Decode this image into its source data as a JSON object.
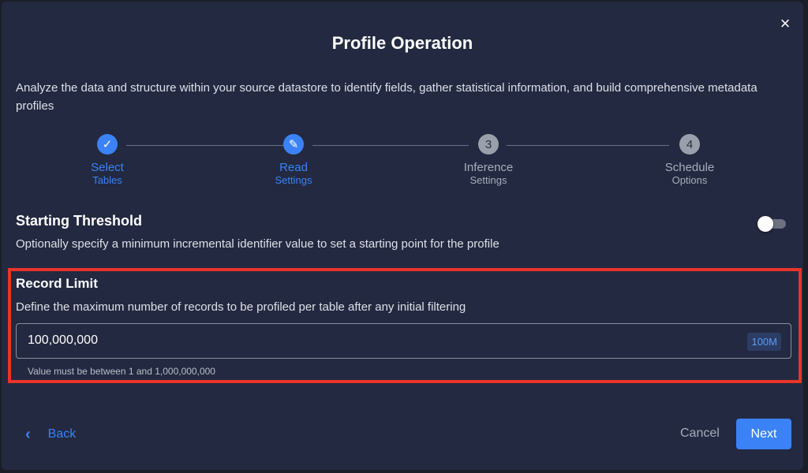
{
  "modal": {
    "title": "Profile Operation",
    "description": "Analyze the data and structure within your source datastore to identify fields, gather statistical information, and build comprehensive metadata profiles",
    "close_icon": "×"
  },
  "stepper": {
    "steps": [
      {
        "marker": "✓",
        "title": "Select",
        "subtitle": "Tables",
        "state": "completed"
      },
      {
        "marker": "✎",
        "title": "Read",
        "subtitle": "Settings",
        "state": "current"
      },
      {
        "marker": "3",
        "title": "Inference",
        "subtitle": "Settings",
        "state": "upcoming"
      },
      {
        "marker": "4",
        "title": "Schedule",
        "subtitle": "Options",
        "state": "upcoming"
      }
    ]
  },
  "starting_threshold": {
    "title": "Starting Threshold",
    "description": "Optionally specify a minimum incremental identifier value to set a starting point for the profile",
    "enabled": false
  },
  "record_limit": {
    "title": "Record Limit",
    "description": "Define the maximum number of records to be profiled per table after any initial filtering",
    "value": "100,000,000",
    "badge": "100M",
    "hint": "Value must be between 1 and 1,000,000,000"
  },
  "footer": {
    "back_icon": "‹",
    "back_label": "Back",
    "cancel_label": "Cancel",
    "next_label": "Next"
  },
  "colors": {
    "accent": "#3b82f6",
    "modal_bg": "#232940",
    "highlight": "#e8352a"
  }
}
